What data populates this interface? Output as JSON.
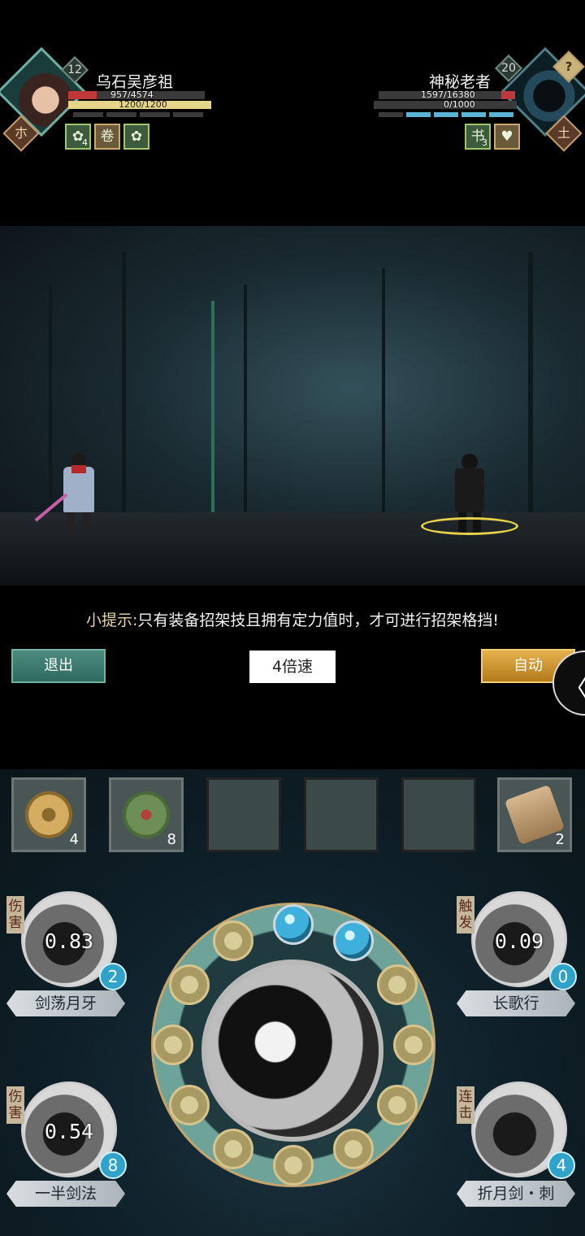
{
  "player": {
    "name": "乌石吴彦祖",
    "level": "12",
    "hp_text": "957/4574",
    "hp_fraction": 0.21,
    "focus_text": "1200/1200",
    "focus_fraction": 1.0,
    "badge_glyph": "朩",
    "buffs": [
      {
        "icon": "lotus-icon",
        "glyph": "✿",
        "count": "4"
      },
      {
        "icon": "scroll-icon",
        "glyph": "卷",
        "count": ""
      },
      {
        "icon": "lotus-plus-icon",
        "glyph": "✿",
        "count": ""
      }
    ]
  },
  "enemy": {
    "name": "神秘老者",
    "level": "20",
    "hp_text": "1597/16380",
    "hp_fraction": 0.1,
    "focus_text": "0/1000",
    "focus_fraction": 0.0,
    "badge_glyph": "土",
    "unknown_glyph": "?",
    "energy_segments": [
      false,
      true,
      true,
      true,
      true
    ],
    "buffs": [
      {
        "icon": "book-icon",
        "glyph": "书",
        "count": "3"
      },
      {
        "icon": "broken-heart-icon",
        "glyph": "♥",
        "count": ""
      }
    ]
  },
  "tip": {
    "prefix": "小提示:",
    "text": "只有装备招架技且拥有定力值时，才可进行招架格挡!"
  },
  "controls": {
    "exit_label": "退出",
    "speed_label": "4倍速",
    "auto_label": "自动",
    "collapse_glyph": "〈"
  },
  "items": [
    {
      "name": "coins-icon",
      "count": "4",
      "color": "#c8a25c"
    },
    {
      "name": "herb-icon",
      "count": "8",
      "color": "#7a9a5a"
    },
    {
      "name": "empty-slot",
      "count": ""
    },
    {
      "name": "empty-slot",
      "count": ""
    },
    {
      "name": "empty-slot",
      "count": ""
    },
    {
      "name": "token-icon",
      "count": "2",
      "color": "#b99a72"
    }
  ],
  "skills": [
    {
      "name": "剑荡月牙",
      "tag": "伤害",
      "value": "0.83",
      "count": "2"
    },
    {
      "name": "长歌行",
      "tag": "触发",
      "value": "0.09",
      "count": "0"
    },
    {
      "name": "一半剑法",
      "tag": "伤害",
      "value": "0.54",
      "count": "8"
    },
    {
      "name": "折月剑・刺",
      "tag": "连击",
      "value": "",
      "count": "4"
    }
  ],
  "wheel": {
    "energy_filled": 2,
    "energy_total": 12
  }
}
